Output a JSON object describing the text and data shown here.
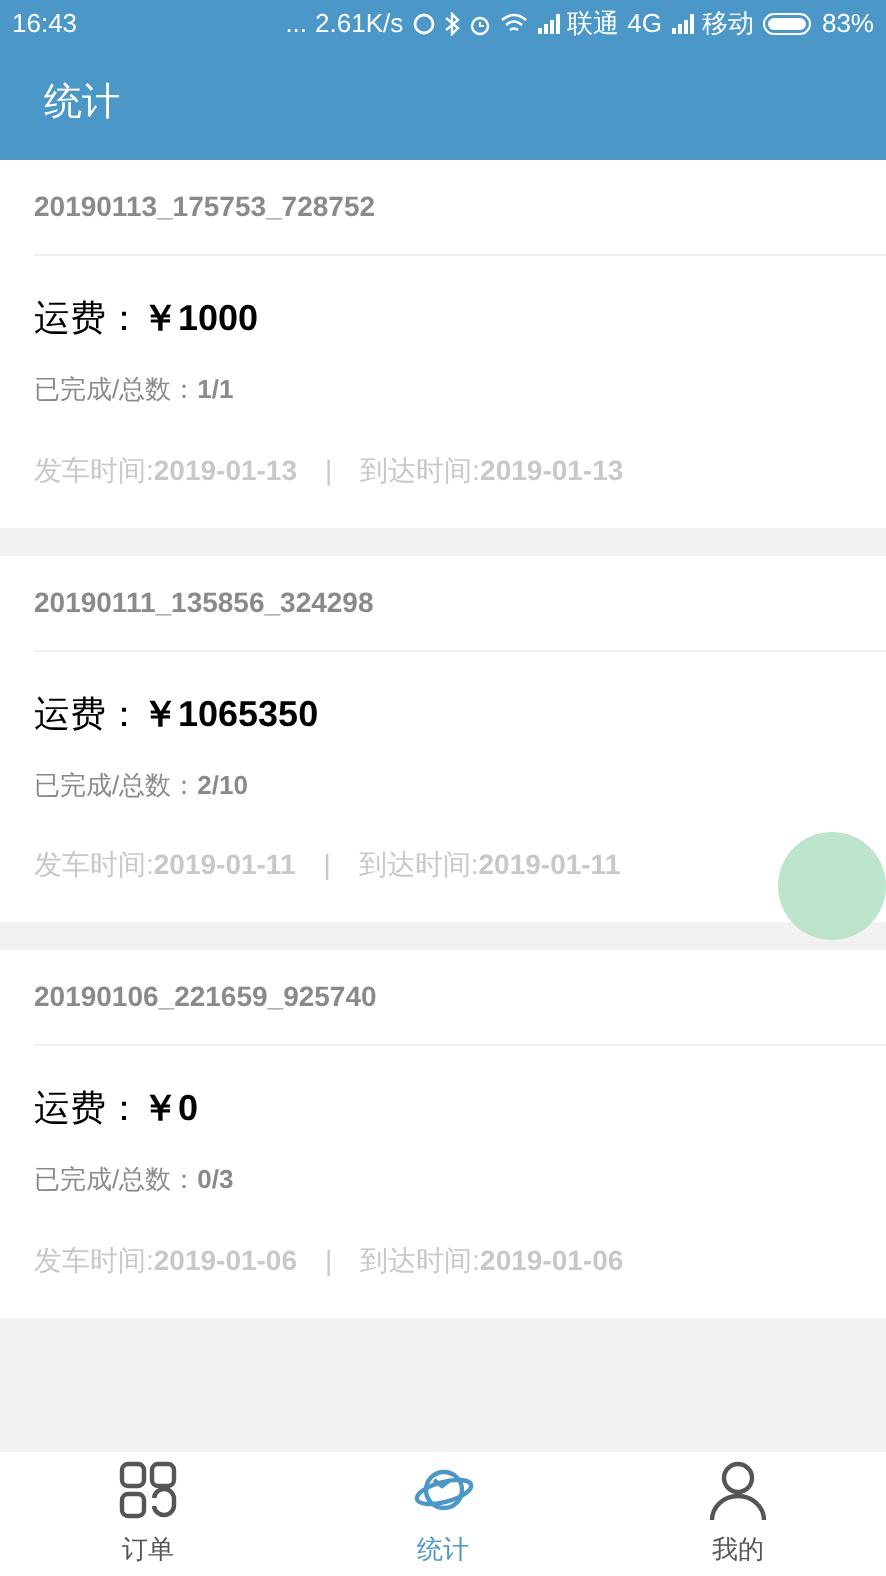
{
  "status_bar": {
    "time": "16:43",
    "dots": "...",
    "speed": "2.61K/s",
    "carrier_1": "联通",
    "network": "4G",
    "carrier_2": "移动",
    "battery": "83%"
  },
  "header": {
    "title": "统计"
  },
  "orders": [
    {
      "id": "20190113_175753_728752",
      "fee_label": "运费：",
      "fee": "￥1000",
      "progress_label": "已完成/总数：",
      "progress": "1/1",
      "depart_label": "发车时间:",
      "depart": "2019-01-13",
      "separator": "|",
      "arrive_label": "到达时间:",
      "arrive": "2019-01-13"
    },
    {
      "id": "20190111_135856_324298",
      "fee_label": "运费：",
      "fee": "￥1065350",
      "progress_label": "已完成/总数：",
      "progress": "2/10",
      "depart_label": "发车时间:",
      "depart": "2019-01-11",
      "separator": "|",
      "arrive_label": "到达时间:",
      "arrive": "2019-01-11"
    },
    {
      "id": "20190106_221659_925740",
      "fee_label": "运费：",
      "fee": "￥0",
      "progress_label": "已完成/总数：",
      "progress": "0/3",
      "depart_label": "发车时间:",
      "depart": "2019-01-06",
      "separator": "|",
      "arrive_label": "到达时间:",
      "arrive": "2019-01-06"
    }
  ],
  "tabs": [
    {
      "label": "订单",
      "kind": "grid",
      "selected": false
    },
    {
      "label": "统计",
      "kind": "planet",
      "selected": true
    },
    {
      "label": "我的",
      "kind": "person",
      "selected": false
    }
  ]
}
